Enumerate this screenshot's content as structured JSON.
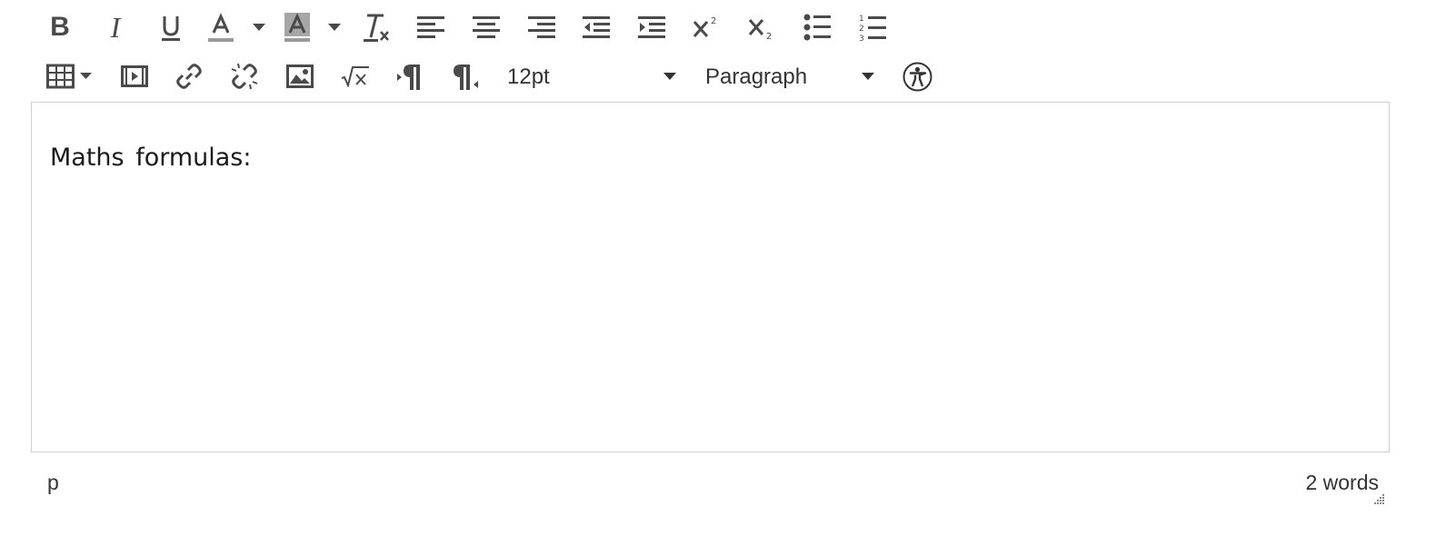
{
  "toolbar_row1": {
    "buttons": [
      {
        "name": "bold",
        "icon": "bold-icon",
        "glyph": "B"
      },
      {
        "name": "italic",
        "icon": "italic-icon",
        "glyph": "I"
      },
      {
        "name": "underline",
        "icon": "underline-icon"
      },
      {
        "name": "text-color",
        "icon": "text-color-icon"
      },
      {
        "name": "background-color",
        "icon": "background-color-icon"
      },
      {
        "name": "clear-formatting",
        "icon": "clear-formatting-icon"
      },
      {
        "name": "align-left",
        "icon": "align-left-icon"
      },
      {
        "name": "align-center",
        "icon": "align-center-icon"
      },
      {
        "name": "align-right",
        "icon": "align-right-icon"
      },
      {
        "name": "decrease-indent",
        "icon": "outdent-icon"
      },
      {
        "name": "increase-indent",
        "icon": "indent-icon"
      },
      {
        "name": "superscript",
        "icon": "superscript-icon"
      },
      {
        "name": "subscript",
        "icon": "subscript-icon"
      },
      {
        "name": "bullet-list",
        "icon": "bullet-list-icon"
      },
      {
        "name": "numbered-list",
        "icon": "numbered-list-icon"
      }
    ]
  },
  "toolbar_row2": {
    "buttons": [
      {
        "name": "table",
        "icon": "table-icon"
      },
      {
        "name": "media",
        "icon": "film-icon"
      },
      {
        "name": "link",
        "icon": "link-icon"
      },
      {
        "name": "unlink",
        "icon": "unlink-icon"
      },
      {
        "name": "image",
        "icon": "image-icon"
      },
      {
        "name": "math",
        "icon": "square-root-icon"
      },
      {
        "name": "ltr",
        "icon": "ltr-paragraph-icon"
      },
      {
        "name": "rtl",
        "icon": "rtl-paragraph-icon"
      },
      {
        "name": "accessibility",
        "icon": "accessibility-icon"
      }
    ],
    "font_size": {
      "value": "12pt"
    },
    "block_format": {
      "value": "Paragraph"
    }
  },
  "editor": {
    "content": "Maths formulas:"
  },
  "status_bar": {
    "path": "p",
    "word_count": "2 words"
  },
  "colors": {
    "icon": "#4a4a4a",
    "text_color_underline": "#9a9a9a",
    "background_color_fill": "#a6a6a6",
    "border": "#cfcfcf"
  }
}
